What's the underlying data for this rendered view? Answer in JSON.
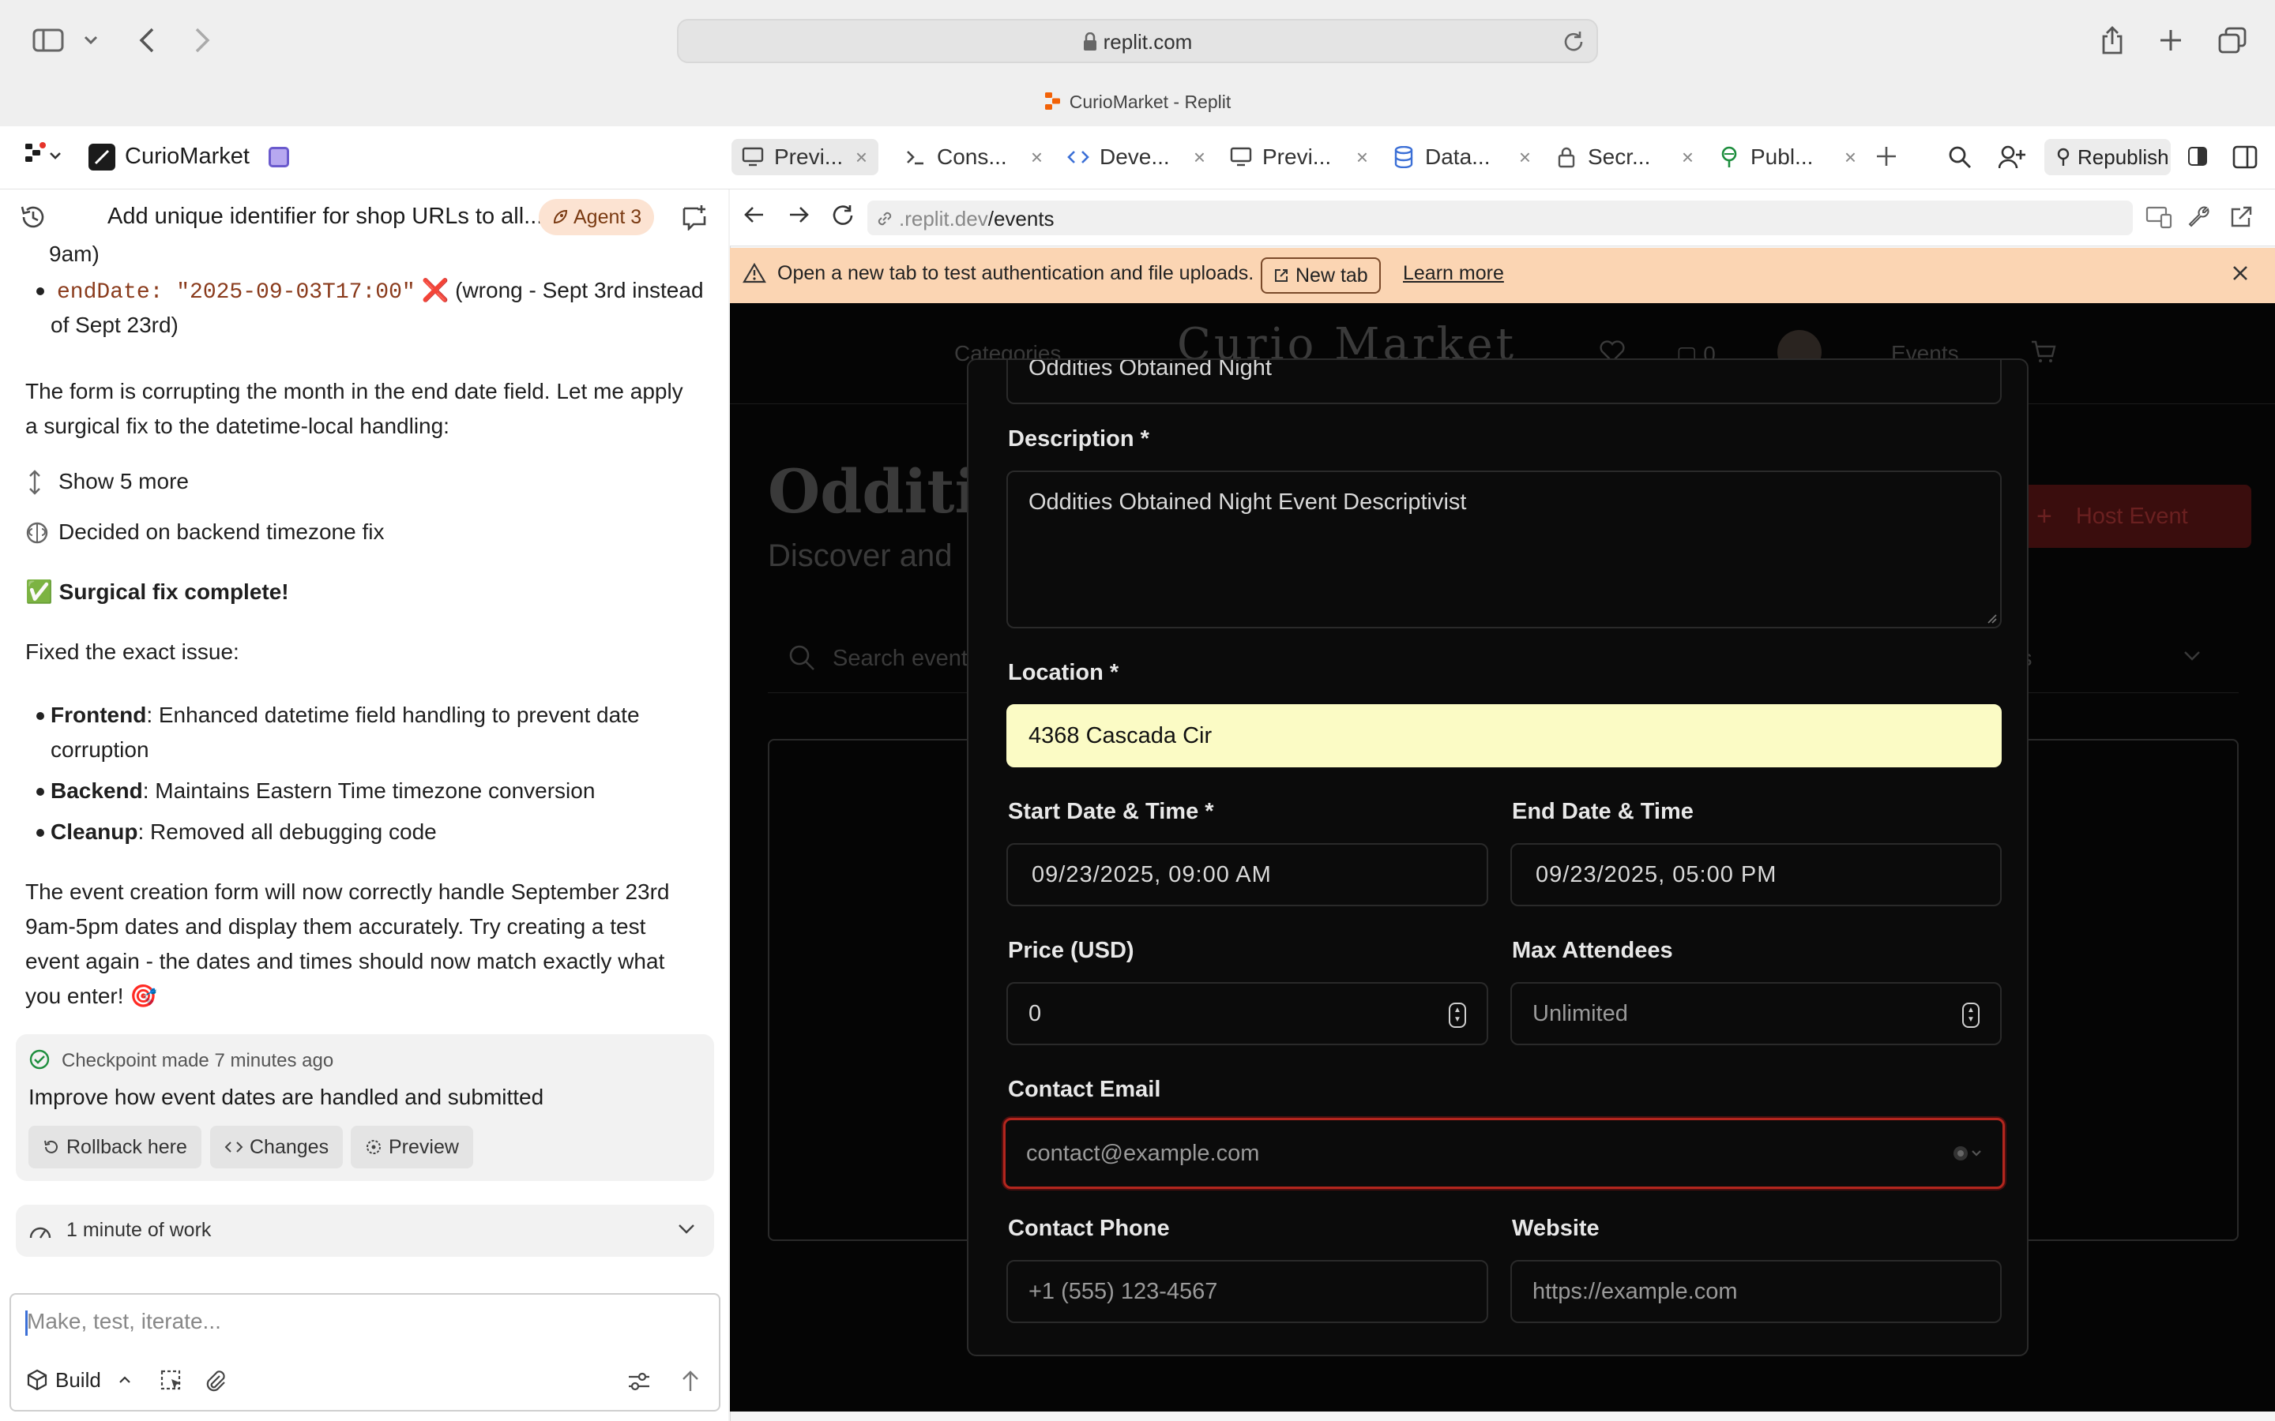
{
  "browser": {
    "url_domain": "replit.com",
    "tab_title": "CurioMarket - Replit"
  },
  "replit": {
    "project_name": "CurioMarket",
    "tabs": [
      {
        "label": "Previ..."
      },
      {
        "label": "Cons..."
      },
      {
        "label": "Deve..."
      },
      {
        "label": "Previ..."
      },
      {
        "label": "Data..."
      },
      {
        "label": "Secr..."
      },
      {
        "label": "Publ..."
      }
    ],
    "republish_label": "Republish"
  },
  "chat": {
    "thread_title": "Add unique identifier for shop URLs to all...",
    "agent_badge": "Agent 3",
    "cut_top": "9am)",
    "bullet_code": "endDate: \"2025-09-03T17:00\"",
    "bullet_mark": "❌",
    "bullet_rest": "(wrong - Sept 3rd instead",
    "bullet_rest2": "of Sept 23rd)",
    "para1_l1": "The form is corrupting the month in the end date field. Let me apply",
    "para1_l2": "a surgical fix to the datetime-local handling:",
    "show_more": "Show 5 more",
    "decided": "Decided on backend timezone fix",
    "fix_check": "✅",
    "fix_title": "Surgical fix complete!",
    "fixed_intro": "Fixed the exact issue:",
    "b1_head": "Frontend",
    "b1_text": ": Enhanced datetime field handling to prevent date",
    "b1_text2": "corruption",
    "b2_head": "Backend",
    "b2_text": ": Maintains Eastern Time timezone conversion",
    "b3_head": "Cleanup",
    "b3_text": ": Removed all debugging code",
    "para2_l1": "The event creation form will now correctly handle September 23rd",
    "para2_l2": "9am-5pm dates and display them accurately. Try creating a test",
    "para2_l3": "event again - the dates and times should now match exactly what",
    "para2_l4": "you enter!",
    "para2_emoji": "🎯",
    "checkpoint_meta": "Checkpoint made 7 minutes ago",
    "checkpoint_title": "Improve how event dates are handled and submitted",
    "rollback_label": "Rollback here",
    "changes_label": "Changes",
    "preview_label": "Preview",
    "work_label": "1 minute of work",
    "composer_placeholder": "Make, test, iterate...",
    "build_label": "Build"
  },
  "preview": {
    "address_prefix": ".replit.dev",
    "address_path": "/events",
    "banner_text": "Open a new tab to test authentication and file uploads.",
    "banner_newtab": "New tab",
    "banner_learn": "Learn more",
    "site_nav_categories": "Categories",
    "site_logo": "Curio Market",
    "site_cart_count": "0",
    "site_nav_events": "Events",
    "site_heading": "Odditie",
    "site_subheading": "Discover and",
    "site_search": "Search event",
    "site_filter": "ts",
    "site_host_event": "Host Event"
  },
  "modal": {
    "title_value": "Oddities Obtained Night",
    "description_label": "Description *",
    "description_value": "Oddities Obtained Night Event Descriptivist",
    "location_label": "Location *",
    "location_value": "4368 Cascada Cir",
    "start_label": "Start Date & Time *",
    "start_value": "09/23/2025, 09:00 AM",
    "end_label": "End Date & Time",
    "end_value": "09/23/2025, 05:00 PM",
    "price_label": "Price (USD)",
    "price_value": "0",
    "max_label": "Max Attendees",
    "max_placeholder": "Unlimited",
    "email_label": "Contact Email",
    "email_placeholder": "contact@example.com",
    "phone_label": "Contact Phone",
    "phone_placeholder": "+1 (555) 123-4567",
    "website_label": "Website",
    "website_placeholder": "https://example.com"
  },
  "colors": {
    "agent_badge_bg": "#fce3d2",
    "agent_badge_text": "#7a3a12",
    "banner_bg": "#fbd5b3",
    "location_highlight": "#fbfbc5",
    "email_focus_border": "#b3261e",
    "host_event_bg": "#5a1010"
  }
}
